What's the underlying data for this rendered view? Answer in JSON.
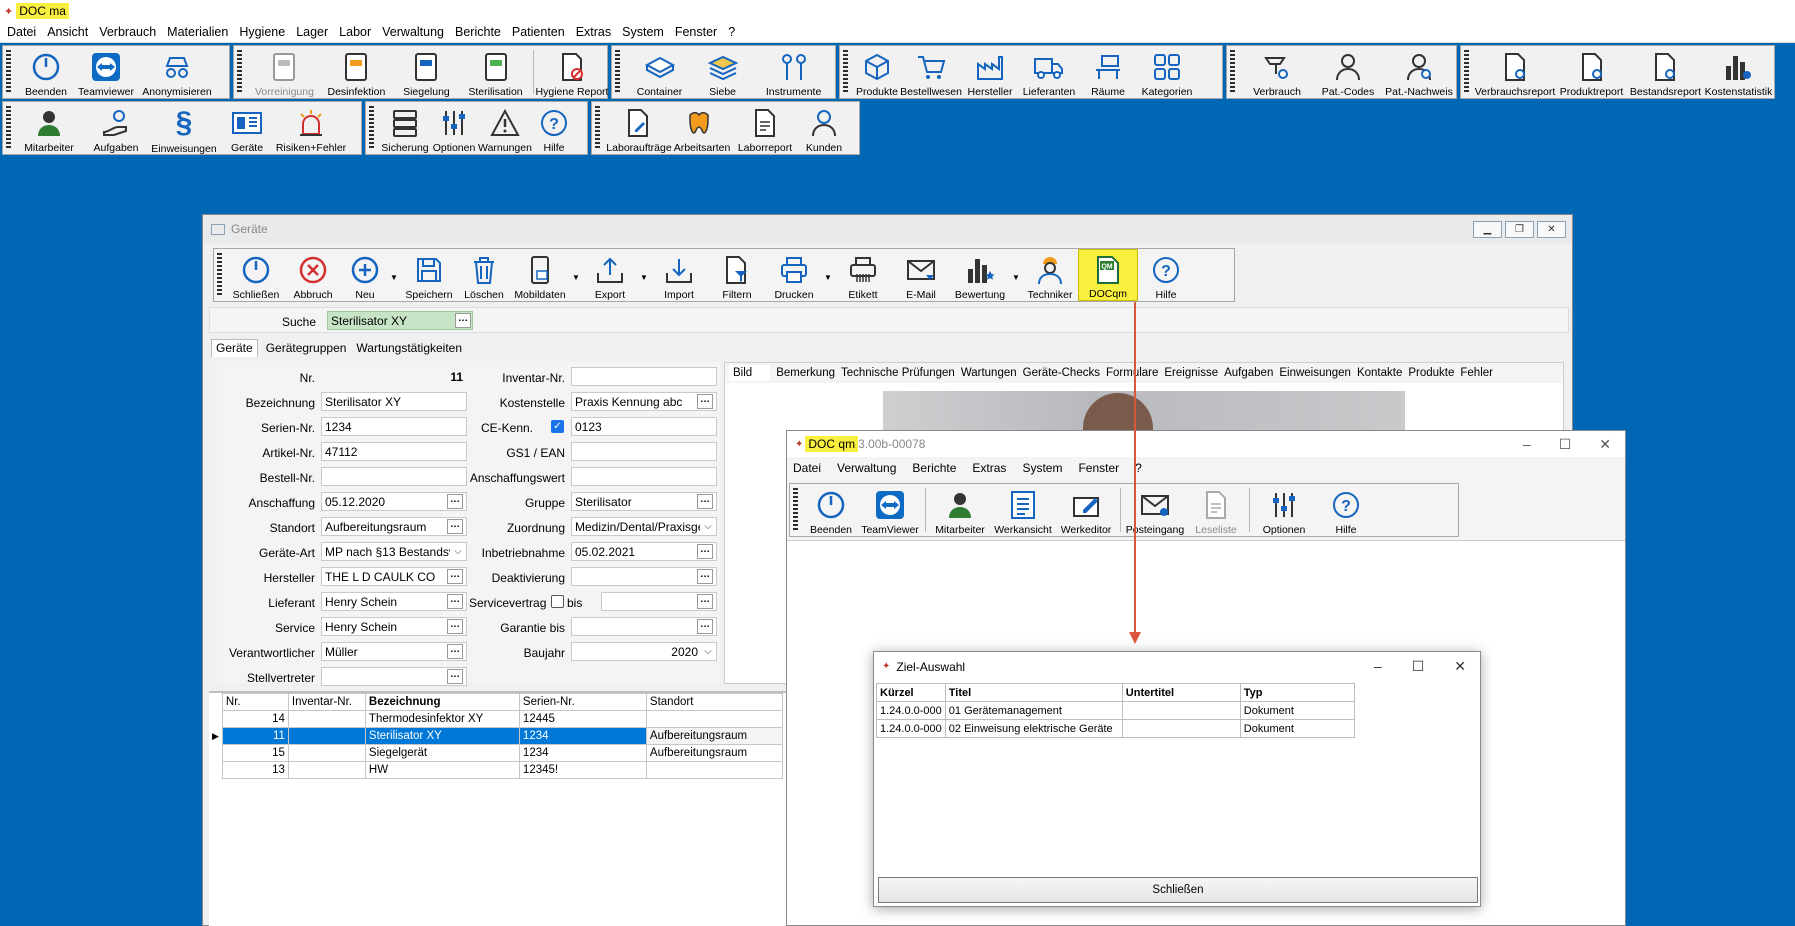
{
  "app": {
    "title": "DOC ma",
    "menu": [
      "Datei",
      "Ansicht",
      "Verbrauch",
      "Materialien",
      "Hygiene",
      "Lager",
      "Labor",
      "Verwaltung",
      "Berichte",
      "Patienten",
      "Extras",
      "System",
      "Fenster",
      "?"
    ]
  },
  "toolbar_row1": [
    "Beenden",
    "Teamviewer",
    "Anonymisieren",
    "Vorreinigung",
    "Desinfektion",
    "Siegelung",
    "Sterilisation",
    "Hygiene Report",
    "Container",
    "Siebe",
    "Instrumente",
    "Produkte",
    "Bestellwesen",
    "Hersteller",
    "Lieferanten",
    "Räume",
    "Kategorien",
    "Verbrauch",
    "Pat.-Codes",
    "Pat.-Nachweis",
    "Verbrauchsreport",
    "Produktreport",
    "Bestandsreport",
    "Kostenstatistik"
  ],
  "toolbar_row2": [
    "Mitarbeiter",
    "Aufgaben",
    "Einweisungen",
    "Geräte",
    "Risiken+Fehler",
    "Sicherung",
    "Optionen",
    "Warnungen",
    "Hilfe",
    "Laboraufträge",
    "Arbeitsarten",
    "Laborreport",
    "Kunden"
  ],
  "geraete": {
    "title": "Geräte",
    "toolbar": [
      "Schließen",
      "Abbruch",
      "Neu",
      "Speichern",
      "Löschen",
      "Mobildaten",
      "Export",
      "Import",
      "Filtern",
      "Drucken",
      "Etikett",
      "E-Mail",
      "Bewertung",
      "Techniker",
      "DOCqm",
      "Hilfe"
    ],
    "search_label": "Suche",
    "search_value": "Sterilisator XY",
    "tabs": [
      "Geräte",
      "Gerätegruppen",
      "Wartungstätigkeiten"
    ],
    "right_tabs": [
      "Bild",
      "Bemerkung",
      "Technische Prüfungen",
      "Wartungen",
      "Geräte-Checks",
      "Formulare",
      "Ereignisse",
      "Aufgaben",
      "Einweisungen",
      "Kontakte",
      "Produkte",
      "Fehler"
    ],
    "form": {
      "nr_label": "Nr.",
      "nr": "11",
      "bez_label": "Bezeichnung",
      "bez": "Sterilisator XY",
      "serien_label": "Serien-Nr.",
      "serien": "1234",
      "artikel_label": "Artikel-Nr.",
      "artikel": "47112",
      "bestell_label": "Bestell-Nr.",
      "bestell": "",
      "anschaffung_label": "Anschaffung",
      "anschaffung": "05.12.2020",
      "standort_label": "Standort",
      "standort": "Aufbereitungsraum",
      "art_label": "Geräte-Art",
      "art": "MP nach §13 Bestandsve",
      "hersteller_label": "Hersteller",
      "hersteller": "THE L D CAULK CO",
      "lieferant_label": "Lieferant",
      "lieferant": "Henry Schein",
      "service_label": "Service",
      "service": "Henry Schein",
      "verantw_label": "Verantwortlicher",
      "verantw": "Müller",
      "stellv_label": "Stellvertreter",
      "stellv": "",
      "inventar_label": "Inventar-Nr.",
      "inventar": "",
      "kosten_label": "Kostenstelle",
      "kosten": "Praxis Kennung abc",
      "ce_label": "CE-Kenn.",
      "ce": "0123",
      "gs1_label": "GS1 / EAN",
      "gs1": "",
      "wert_label": "Anschaffungswert",
      "wert": "",
      "gruppe_label": "Gruppe",
      "gruppe": "Sterilisator",
      "zuordnung_label": "Zuordnung",
      "zuordnung": "Medizin/Dental/Praxisgerä",
      "inbetrieb_label": "Inbetriebnahme",
      "inbetrieb": "05.02.2021",
      "deakt_label": "Deaktivierung",
      "deakt": "",
      "servicev_label": "Servicevertrag",
      "bis_label": "bis",
      "bis": "",
      "garantie_label": "Garantie bis",
      "garantie": "",
      "baujahr_label": "Baujahr",
      "baujahr": "2020"
    },
    "grid": {
      "headers": [
        "Nr.",
        "Inventar-Nr.",
        "Bezeichnung",
        "Serien-Nr.",
        "Standort"
      ],
      "rows": [
        [
          "14",
          "",
          "Thermodesinfektor XY",
          "12445",
          ""
        ],
        [
          "11",
          "",
          "Sterilisator XY",
          "1234",
          "Aufbereitungsraum"
        ],
        [
          "15",
          "",
          "Siegelgerät",
          "1234",
          "Aufbereitungsraum"
        ],
        [
          "13",
          "",
          "HW",
          "12345!",
          ""
        ]
      ]
    }
  },
  "docqm": {
    "title_hl": "DOC qm",
    "title_rest": "3.00b-00078",
    "menu": [
      "Datei",
      "Verwaltung",
      "Berichte",
      "Extras",
      "System",
      "Fenster",
      "?"
    ],
    "toolbar": [
      "Beenden",
      "TeamViewer",
      "Mitarbeiter",
      "Werkansicht",
      "Werkeditor",
      "Posteingang",
      "Leseliste",
      "Optionen",
      "Hilfe"
    ]
  },
  "ziel": {
    "title": "Ziel-Auswahl",
    "headers": [
      "Kürzel",
      "Titel",
      "Untertitel",
      "Typ"
    ],
    "rows": [
      [
        "1.24.0.0-000",
        "01  Gerätemanagement",
        "",
        "Dokument"
      ],
      [
        "1.24.0.0-000",
        "02  Einweisung elektrische Geräte",
        "",
        "Dokument"
      ]
    ],
    "close": "Schließen"
  },
  "colors": {
    "accent": "#0067b4",
    "selection": "#0078d7",
    "highlight": "#f8ef3f",
    "arrow": "#d9573b"
  }
}
